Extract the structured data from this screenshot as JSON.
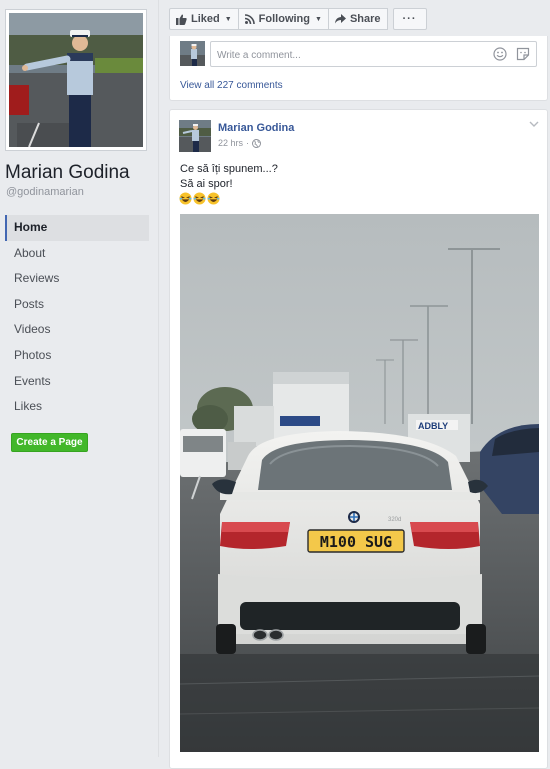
{
  "page": {
    "name": "Marian Godina",
    "handle": "@godinamarian"
  },
  "nav": [
    {
      "label": "Home",
      "active": true
    },
    {
      "label": "About"
    },
    {
      "label": "Reviews"
    },
    {
      "label": "Posts"
    },
    {
      "label": "Videos"
    },
    {
      "label": "Photos"
    },
    {
      "label": "Events"
    },
    {
      "label": "Likes"
    }
  ],
  "create_page_label": "Create a Page",
  "actions": {
    "liked": "Liked",
    "following": "Following",
    "share": "Share",
    "more": "···"
  },
  "comment": {
    "placeholder": "Write a comment...",
    "view_all": "View all 227 comments"
  },
  "post": {
    "author": "Marian Godina",
    "time": "22 hrs",
    "line1": "Ce să îți spunem...?",
    "line2": "Să ai spor!",
    "emojis": [
      "laughing-emoji",
      "laughing-emoji",
      "laughing-emoji"
    ],
    "plate": "M100 SUG",
    "sign_text": "ADBLY"
  },
  "colors": {
    "link": "#385898",
    "accent": "#4267b2",
    "create_btn": "#42b72a",
    "background": "#e9ebee"
  }
}
